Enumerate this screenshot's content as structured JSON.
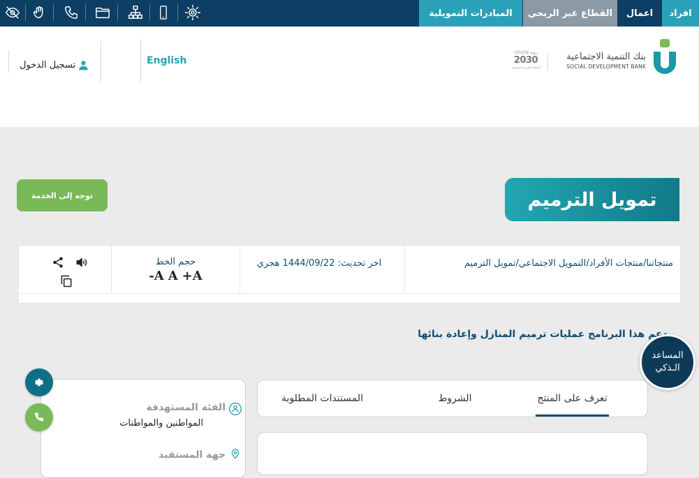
{
  "topbar": {
    "tabs": {
      "individuals": "افراد",
      "business": "اعمال",
      "nonprofit": "القطاع غير الربحي",
      "initiatives": "المبادرات التمويلية"
    },
    "icons": [
      "eye-slash-icon",
      "hand-sign-icon",
      "phone-icon",
      "folder-icon",
      "sitemap-icon",
      "mobile-icon",
      "sun-gear-icon"
    ],
    "colors": {
      "bar": "#0d3e63",
      "active_tab": "#2aa1b8",
      "grey_tab": "#8b9aa4"
    }
  },
  "header": {
    "login": "تسجيل الدخول",
    "language": "English",
    "logo": {
      "name_ar": "بنك التنمية الاجتماعية",
      "name_en": "SOCIAL DEVELOPMENT BANK",
      "vision_word": "VISION",
      "vision_ar": "رؤية",
      "vision_year": "2030",
      "vision_country": "المملكة العربية السعودية"
    }
  },
  "hero": {
    "go_to_service": "توجه إلى الخدمة",
    "title": "تمويل الترميم"
  },
  "infobar": {
    "breadcrumb": "منتجاتنا/منتجات الأفراد/التمويل الاجتماعي/تمويل الترميم",
    "last_update_label": "اخر تحديث:",
    "last_update_value": "1444/09/22 هجري",
    "font_size_label": "حجم الخط",
    "font_controls": {
      "decrease": "A-",
      "normal": "A",
      "increase": "A+"
    }
  },
  "intro": "يدعم هذا البرنامج عمليات ترميم المنازل وإعادة بنائها",
  "assistant": {
    "line1": "المساعد",
    "line2": "الـذكي"
  },
  "tabs": [
    {
      "label": "تعرف على المنتج",
      "active": true
    },
    {
      "label": "الشروط",
      "active": false
    },
    {
      "label": "المستندات المطلوبة",
      "active": false
    }
  ],
  "side_card": {
    "target_label": "الفئة المستهدفة",
    "target_value": "المواطنين والمواطنات",
    "next_label": "جهة المستفيد"
  },
  "colors": {
    "green": "#7ab957",
    "teal": "#1a9aa8",
    "navy": "#0f4c71"
  }
}
